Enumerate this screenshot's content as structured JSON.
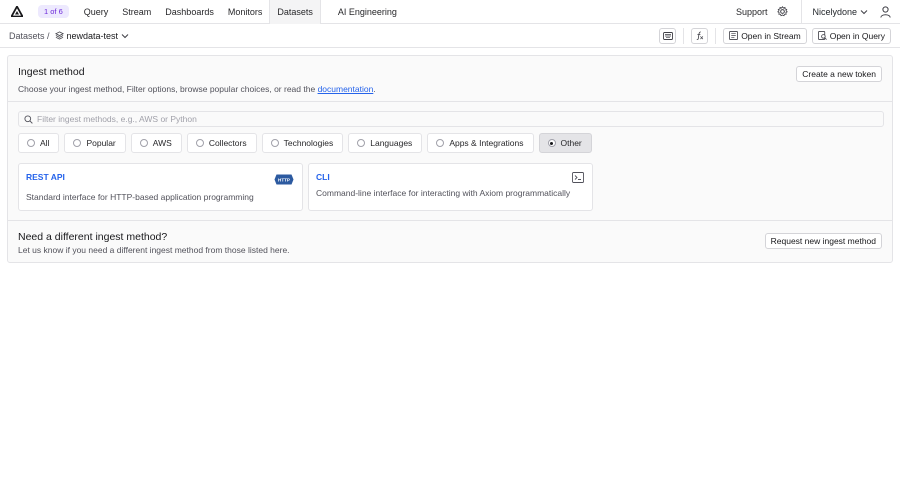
{
  "nav": {
    "counter": "1 of 6",
    "items": [
      "Query",
      "Stream",
      "Dashboards",
      "Monitors",
      "Datasets",
      "AI Engineering"
    ],
    "active": "Datasets",
    "support": "Support",
    "user": "Nicelydone"
  },
  "subbar": {
    "crumb": "Datasets /",
    "dataset": "newdata-test",
    "open_stream": "Open in Stream",
    "open_query": "Open in Query"
  },
  "ingest": {
    "title": "Ingest method",
    "desc_before": "Choose your ingest method, Filter options, browse popular choices, or read the ",
    "desc_link": "documentation",
    "desc_after": ".",
    "create_token": "Create a new token",
    "search_placeholder": "Filter ingest methods, e.g., AWS or Python",
    "chips": [
      "All",
      "Popular",
      "AWS",
      "Collectors",
      "Technologies",
      "Languages",
      "Apps & Integrations",
      "Other"
    ],
    "selected_chip": "Other",
    "cards": [
      {
        "title": "REST API",
        "desc": "Standard interface for HTTP-based application programming",
        "icon": "http-icon",
        "icon_text": "HTTP"
      },
      {
        "title": "CLI",
        "desc": "Command-line interface for interacting with Axiom programmatically",
        "icon": "terminal-icon"
      }
    ]
  },
  "footer": {
    "title": "Need a different ingest method?",
    "desc": "Let us know if you need a different ingest method from those listed here.",
    "button": "Request new ingest method"
  },
  "colors": {
    "accent": "#2563eb",
    "counter_bg": "#ede9fe",
    "counter_fg": "#6d28d9"
  }
}
